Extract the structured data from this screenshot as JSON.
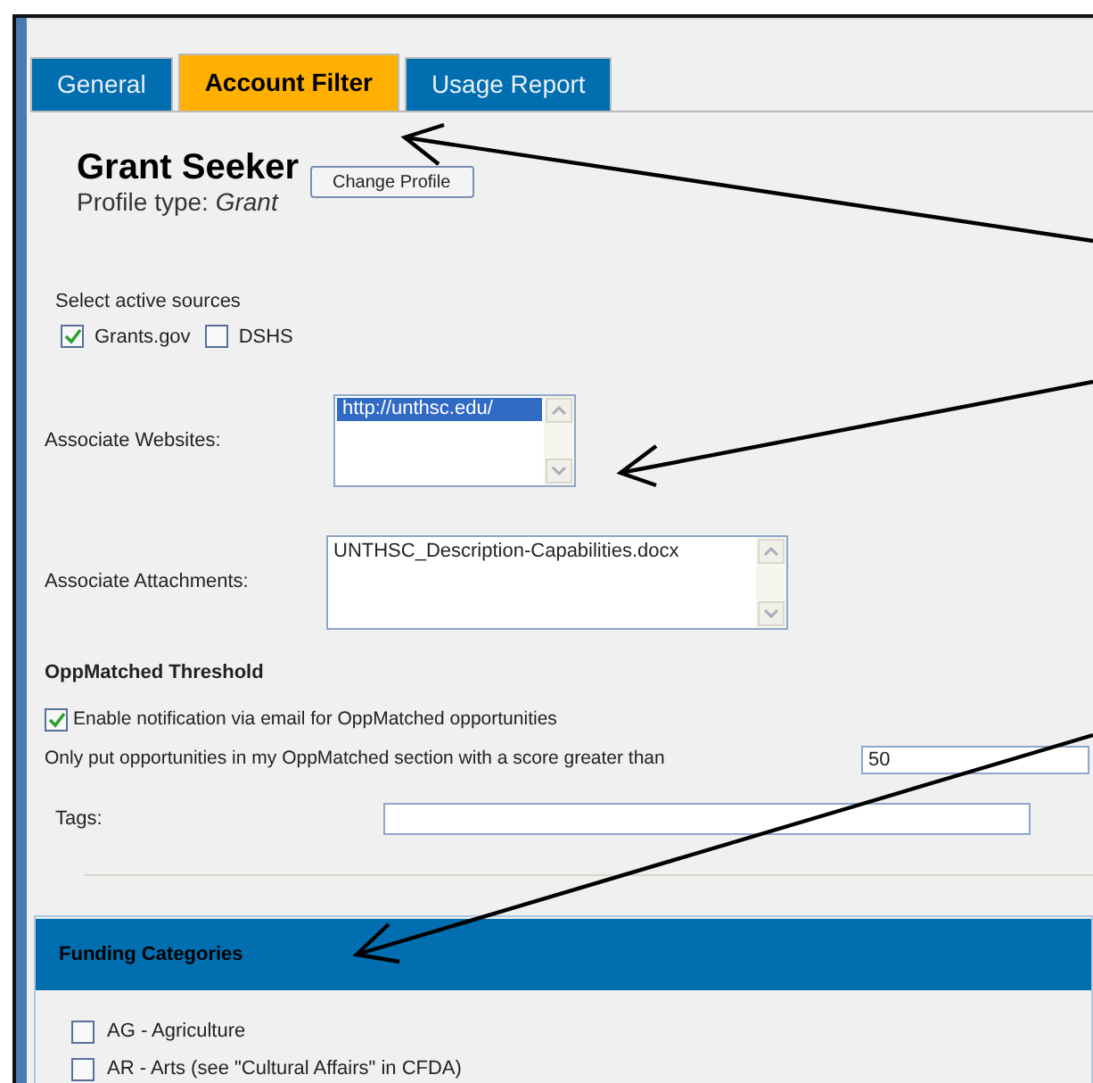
{
  "tabs": [
    {
      "label": "General",
      "selected": false
    },
    {
      "label": "Account Filter",
      "selected": true
    },
    {
      "label": "Usage Report",
      "selected": false
    }
  ],
  "profile": {
    "name": "Grant Seeker",
    "type_label": "Profile type: ",
    "type_value": "Grant",
    "change_button": "Change Profile"
  },
  "sources": {
    "label": "Select active sources",
    "items": [
      {
        "label": "Grants.gov",
        "checked": true
      },
      {
        "label": "DSHS",
        "checked": false
      }
    ]
  },
  "websites": {
    "label": "Associate Websites:",
    "items": [
      {
        "text": "http://unthsc.edu/",
        "selected": true
      }
    ]
  },
  "attachments": {
    "label": "Associate Attachments:",
    "items": [
      {
        "text": "UNTHSC_Description-Capabilities.docx",
        "selected": false
      }
    ]
  },
  "threshold": {
    "heading": "OppMatched Threshold",
    "notify": {
      "label": "Enable notification via email for OppMatched opportunities",
      "checked": true
    },
    "score_label": "Only put opportunities in my OppMatched section with a score greater than",
    "score_value": "50"
  },
  "tags": {
    "label": "Tags:"
  },
  "funding": {
    "heading": "Funding Categories",
    "items": [
      {
        "label": "AG - Agriculture",
        "checked": false
      },
      {
        "label": "AR - Arts (see \"Cultural Affairs\" in CFDA)",
        "checked": false
      }
    ]
  }
}
